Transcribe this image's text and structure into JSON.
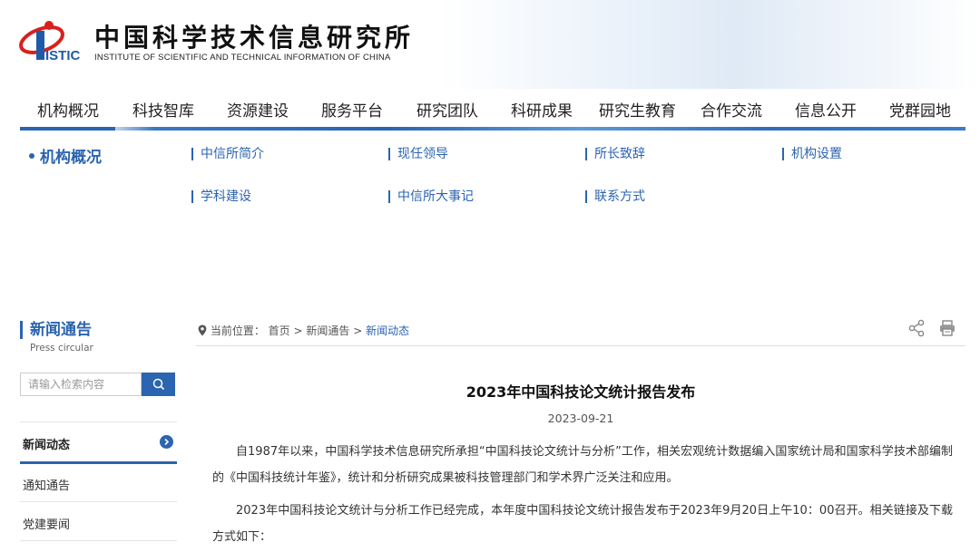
{
  "header": {
    "logo_mark": "ISTIC",
    "name_cn": "中国科学技术信息研究所",
    "name_en": "INSTITUTE OF SCIENTIFIC AND TECHNICAL INFORMATION OF CHINA"
  },
  "nav": {
    "items": [
      "机构概况",
      "科技智库",
      "资源建设",
      "服务平台",
      "研究团队",
      "科研成果",
      "研究生教育",
      "合作交流",
      "信息公开",
      "党群园地"
    ],
    "active": "机构概况"
  },
  "submenu": {
    "title": "机构概况",
    "links": [
      "中信所简介",
      "现任领导",
      "所长致辞",
      "机构设置",
      "学科建设",
      "中信所大事记",
      "联系方式"
    ]
  },
  "sidebar": {
    "title": "新闻通告",
    "subtitle": "Press circular",
    "search_placeholder": "请输入检索内容",
    "items": [
      "新闻动态",
      "通知通告",
      "党建要闻"
    ],
    "active": "新闻动态"
  },
  "breadcrumb": {
    "label": "当前位置：",
    "items": [
      "首页",
      "新闻通告",
      "新闻动态"
    ],
    "separator": ">"
  },
  "article": {
    "title": "2023年中国科技论文统计报告发布",
    "date": "2023-09-21",
    "paragraphs": [
      "自1987年以来，中国科学技术信息研究所承担“中国科技论文统计与分析”工作，相关宏观统计数据编入国家统计局和国家科学技术部编制的《中国科技统计年鉴》，统计和分析研究成果被科技管理部门和学术界广泛关注和应用。",
      "2023年中国科技论文统计与分析工作已经完成，本年度中国科技论文统计报告发布于2023年9月20日上午10：00召开。相关链接及下载方式如下："
    ]
  },
  "colors": {
    "accent": "#2b64b0",
    "logo_red": "#d9201c",
    "logo_blue": "#1f5aa8"
  },
  "icons": [
    "location-icon",
    "search-icon",
    "chevron-right-icon",
    "share-icon",
    "print-icon"
  ]
}
